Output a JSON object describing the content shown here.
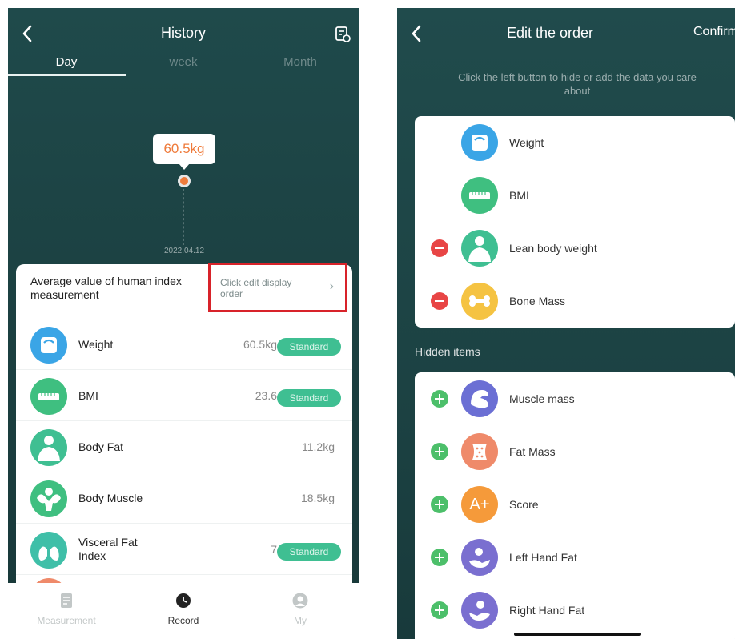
{
  "history": {
    "title": "History",
    "tabs": [
      {
        "label": "Day"
      },
      {
        "label": "week"
      },
      {
        "label": "Month"
      }
    ],
    "chart_bubble": "60.5kg",
    "chart_date": "2022.04.12",
    "card_title": "Average value of human index measurement",
    "edit_hint": "Click edit display order",
    "rows": [
      {
        "label": "Weight",
        "value": "60.5kg",
        "badge": "Standard",
        "icon": "scale-icon"
      },
      {
        "label": "BMI",
        "value": "23.6",
        "badge": "Standard",
        "icon": "ruler-icon"
      },
      {
        "label": "Body Fat",
        "value": "11.2kg",
        "badge": "",
        "icon": "body-fat-icon"
      },
      {
        "label": "Body Muscle",
        "value": "18.5kg",
        "badge": "",
        "icon": "muscle-icon"
      },
      {
        "label": "Visceral Fat Index",
        "value": "7",
        "badge": "Standard",
        "icon": "lungs-icon"
      }
    ],
    "nav": [
      {
        "label": "Measurement",
        "icon": "document-icon"
      },
      {
        "label": "Record",
        "icon": "clock-icon"
      },
      {
        "label": "My",
        "icon": "user-icon"
      }
    ]
  },
  "edit": {
    "title": "Edit the order",
    "confirm": "Confirm",
    "hint": "Click the left button to hide or add the data you care about",
    "visible_items": [
      {
        "label": "Weight",
        "icon": "scale-icon",
        "removable": false
      },
      {
        "label": "BMI",
        "icon": "ruler-icon",
        "removable": false
      },
      {
        "label": "Lean body weight",
        "icon": "body-icon",
        "removable": true
      },
      {
        "label": "Bone Mass",
        "icon": "bone-icon",
        "removable": true
      }
    ],
    "hidden_title": "Hidden items",
    "hidden_items": [
      {
        "label": "Muscle mass",
        "icon": "arm-icon"
      },
      {
        "label": "Fat Mass",
        "icon": "fat-icon"
      },
      {
        "label": "Score",
        "icon": "score-icon",
        "glyph": "A+"
      },
      {
        "label": "Left Hand Fat",
        "icon": "hand-icon"
      },
      {
        "label": "Right Hand Fat",
        "icon": "hand-icon"
      }
    ]
  },
  "colors": {
    "accent_orange": "#ef7b3b",
    "badge_green": "#3fbf92",
    "highlight_red": "#d8232a",
    "minus_red": "#e84545",
    "plus_green": "#4cbf6a"
  }
}
